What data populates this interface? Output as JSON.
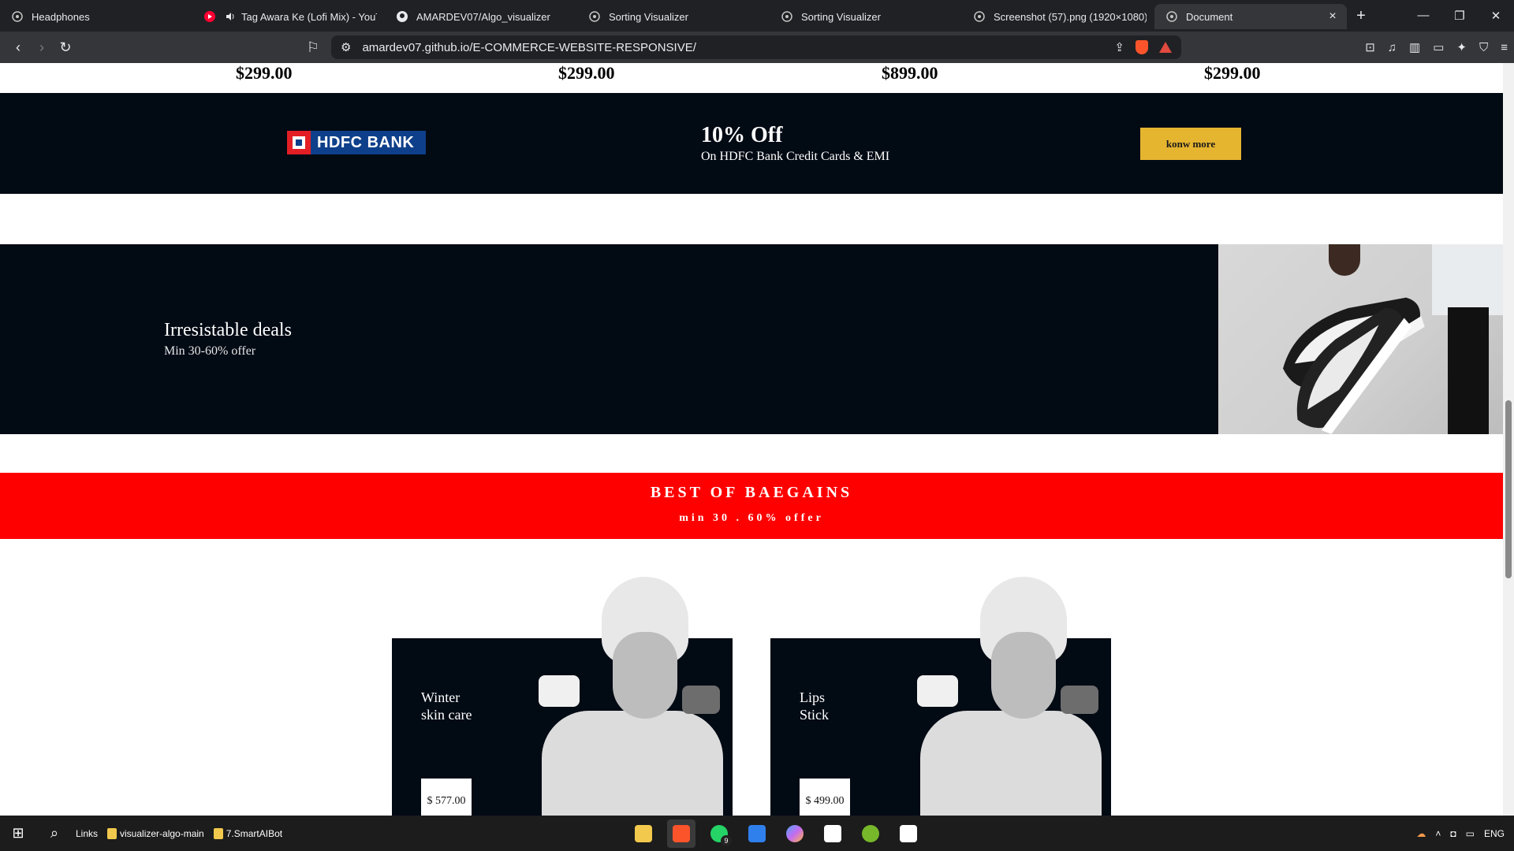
{
  "browser": {
    "tabs": [
      {
        "title": "Headphones",
        "icon": "globe-icon",
        "active": false
      },
      {
        "title": "Tag Awara Ke (Lofi Mix) - YouTube",
        "icon": "youtube-icon",
        "active": false
      },
      {
        "title": "AMARDEV07/Algo_visualizer",
        "icon": "github-icon",
        "active": false
      },
      {
        "title": "Sorting Visualizer",
        "icon": "globe-icon",
        "active": false
      },
      {
        "title": "Sorting Visualizer",
        "icon": "globe-icon",
        "active": false
      },
      {
        "title": "Screenshot (57).png (1920×1080)",
        "icon": "globe-icon",
        "active": false
      },
      {
        "title": "Document",
        "icon": "globe-icon",
        "active": true
      }
    ],
    "url": "amardev07.github.io/E-COMMERCE-WEBSITE-RESPONSIVE/"
  },
  "page": {
    "prices": [
      "$299.00",
      "$299.00",
      "$899.00",
      "$299.00"
    ],
    "hdfc_banner": {
      "logo_text": "HDFC BANK",
      "offer_title": "10% Off",
      "offer_subtitle": "On HDFC Bank Credit Cards & EMI",
      "button_label": "konw more",
      "button_color": "#e6b530"
    },
    "deals": {
      "title": "Irresistable deals",
      "subtitle": "Min 30-60% offer"
    },
    "bargains": {
      "title": "BEST OF BAEGAINS",
      "subtitle": "min 30 . 60% offer",
      "background": "#ff0000"
    },
    "cards": [
      {
        "label_line1": "Winter",
        "label_line2": "skin care",
        "price": "$ 577.00"
      },
      {
        "label_line1": "Lips",
        "label_line2": "Stick",
        "price": "$ 499.00"
      }
    ]
  },
  "taskbar": {
    "links_label": "Links",
    "folders": [
      "visualizer-algo-main",
      "7.SmartAIBot"
    ],
    "whatsapp_badge": "9",
    "language": "ENG"
  }
}
